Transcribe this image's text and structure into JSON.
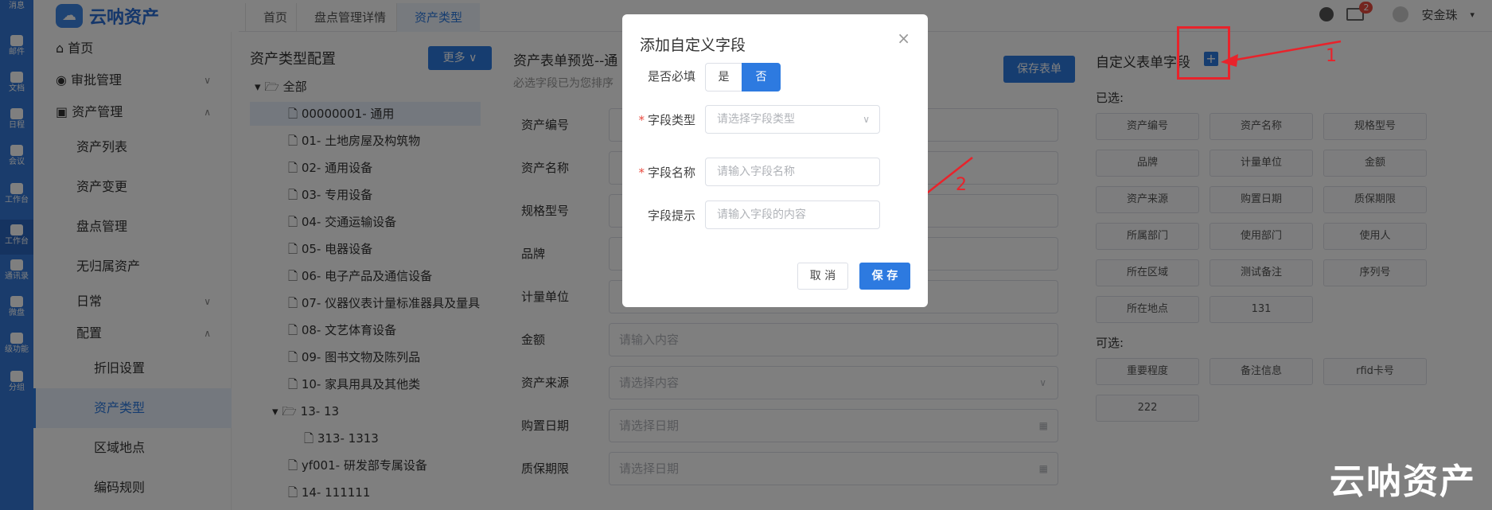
{
  "rail": [
    {
      "label": "消息"
    },
    {
      "label": "邮件"
    },
    {
      "label": "文档"
    },
    {
      "label": "日程"
    },
    {
      "label": "会议"
    },
    {
      "label": "工作台"
    },
    {
      "label": "工作台"
    },
    {
      "label": "通讯录"
    },
    {
      "label": "微盘"
    },
    {
      "label": "级功能"
    },
    {
      "label": "分组"
    }
  ],
  "brand": {
    "mark": "☁",
    "name": "云呐资产"
  },
  "tabs": [
    {
      "label": "首页"
    },
    {
      "label": "盘点管理详情"
    },
    {
      "label": "资产类型"
    }
  ],
  "header": {
    "badge": "2",
    "user": "安金珠"
  },
  "nav": [
    {
      "label": "首页"
    },
    {
      "label": "审批管理"
    },
    {
      "label": "资产管理"
    },
    {
      "label": "资产列表"
    },
    {
      "label": "资产变更"
    },
    {
      "label": "盘点管理"
    },
    {
      "label": "无归属资产"
    },
    {
      "label": "日常"
    },
    {
      "label": "配置"
    },
    {
      "label": "折旧设置"
    },
    {
      "label": "资产类型"
    },
    {
      "label": "区域地点"
    },
    {
      "label": "编码规则"
    }
  ],
  "tree": {
    "title": "资产类型配置",
    "more": "更多",
    "nodes": [
      {
        "label": "全部"
      },
      {
        "label": "00000001- 通用"
      },
      {
        "label": "01- 土地房屋及构筑物"
      },
      {
        "label": "02- 通用设备"
      },
      {
        "label": "03- 专用设备"
      },
      {
        "label": "04- 交通运输设备"
      },
      {
        "label": "05- 电器设备"
      },
      {
        "label": "06- 电子产品及通信设备"
      },
      {
        "label": "07- 仪器仪表计量标准器具及量具"
      },
      {
        "label": "08- 文艺体育设备"
      },
      {
        "label": "09- 图书文物及陈列品"
      },
      {
        "label": "10- 家具用具及其他类"
      },
      {
        "label": "13- 13"
      },
      {
        "label": "313- 1313"
      },
      {
        "label": "yf001- 研发部专属设备"
      },
      {
        "label": "14- 111111"
      }
    ]
  },
  "form": {
    "title": "资产表单预览--通",
    "hint": "必选字段已为您排序",
    "save": "保存表单",
    "rows": [
      {
        "label": "资产编号",
        "placeholder": ""
      },
      {
        "label": "资产名称",
        "placeholder": ""
      },
      {
        "label": "规格型号",
        "placeholder": ""
      },
      {
        "label": "品牌",
        "placeholder": ""
      },
      {
        "label": "计量单位",
        "placeholder": ""
      },
      {
        "label": "金额",
        "placeholder": "请输入内容"
      },
      {
        "label": "资产来源",
        "placeholder": "请选择内容"
      },
      {
        "label": "购置日期",
        "placeholder": "请选择日期"
      },
      {
        "label": "质保期限",
        "placeholder": "请选择日期"
      }
    ]
  },
  "custom": {
    "title": "自定义表单字段",
    "selected_label": "已选:",
    "selected": [
      "资产编号",
      "资产名称",
      "规格型号",
      "品牌",
      "计量单位",
      "金额",
      "资产来源",
      "购置日期",
      "质保期限",
      "所属部门",
      "使用部门",
      "使用人",
      "所在区域",
      "测试备注",
      "序列号",
      "所在地点",
      "131"
    ],
    "optional_label": "可选:",
    "optional": [
      "重要程度",
      "备注信息",
      "rfid卡号",
      "222"
    ]
  },
  "modal": {
    "title": "添加自定义字段",
    "close": "×",
    "required_label": "是否必填",
    "yes": "是",
    "no": "否",
    "type_label": "字段类型",
    "type_placeholder": "请选择字段类型",
    "name_label": "字段名称",
    "name_placeholder": "请输入字段名称",
    "hint_label": "字段提示",
    "hint_placeholder": "请输入字段的内容",
    "cancel": "取 消",
    "save": "保 存"
  },
  "annotations": {
    "one": "1",
    "two": "2"
  },
  "watermark": "云呐资产",
  "colors": {
    "primary": "#2d7ae0",
    "rail": "#3479d8",
    "annotation": "#e8232b"
  }
}
